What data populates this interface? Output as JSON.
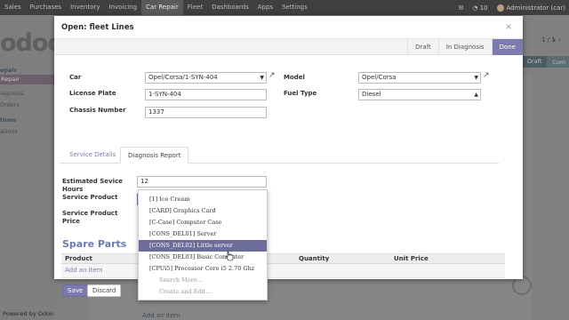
{
  "topbar": {
    "menus": [
      "Sales",
      "Purchases",
      "Inventory",
      "Invoicing",
      "Car Repair",
      "Fleet",
      "Dashboards",
      "Apps",
      "Settings"
    ],
    "active_menu": "Car Repair",
    "notifications": "10",
    "user": "Administrator (car)"
  },
  "background": {
    "logo": "odoo",
    "sidebar": [
      {
        "label": "epair",
        "kind": "head"
      },
      {
        "label": "Repair",
        "kind": "sel"
      },
      {
        "label": "iagnosis",
        "kind": "item"
      },
      {
        "label": "Orders",
        "kind": "item"
      },
      {
        "label": "tions",
        "kind": "head"
      },
      {
        "label": "ations",
        "kind": "item"
      }
    ],
    "pager": "1 / 1",
    "pager_arrows": "‹ ›",
    "status_left": "Draft",
    "status_right": "Com",
    "add_line": "Add an item",
    "powered": "Powered by Odoo"
  },
  "modal": {
    "title": "Open: fleet Lines",
    "close": "×",
    "stages": [
      "Draft",
      "In Diagnosis",
      "Done"
    ],
    "current_stage": "Done",
    "fields": {
      "car_label": "Car",
      "car_value": "Opel/Corsa/1-SYN-404",
      "license_label": "License Plate",
      "license_value": "1-SYN-404",
      "chassis_label": "Chassis Number",
      "chassis_value": "1337",
      "model_label": "Model",
      "model_value": "Opel/Corsa",
      "fuel_label": "Fuel Type",
      "fuel_value": "Diesel"
    },
    "tabs": [
      "Service Details",
      "Diagnosis Report"
    ],
    "active_tab": "Diagnosis Report",
    "diagnosis": {
      "est_hours_label_1": "Estimated Sevice",
      "est_hours_label_2": "Hours",
      "est_hours_value": "12",
      "service_product_label": "Service Product",
      "service_product_value": "",
      "service_price_label_1": "Service Product",
      "service_price_label_2": "Price"
    },
    "spare_parts": {
      "title": "Spare Parts",
      "columns": [
        "Product",
        "Quantity",
        "Unit Price"
      ],
      "add_item": "Add an item"
    },
    "buttons": {
      "save": "Save",
      "discard": "Discard"
    }
  },
  "dropdown": {
    "items": [
      "[1] Ice Cream",
      "[CARD] Graphics Card",
      "[C-Case] Computer Case",
      "[CONS_DEL01] Server",
      "[CONS_DEL02] Little server",
      "[CONS_DEL03] Basic Computer",
      "[CPUi5] Processor Core i5 2.70 Ghz"
    ],
    "hovered": "[CONS_DEL02] Little server",
    "search_more": "Search More...",
    "create_edit": "Create and Edit..."
  },
  "colors": {
    "accent": "#7c7bad",
    "navbar": "#3f3f3f",
    "title_blue": "#6c7bb0"
  }
}
